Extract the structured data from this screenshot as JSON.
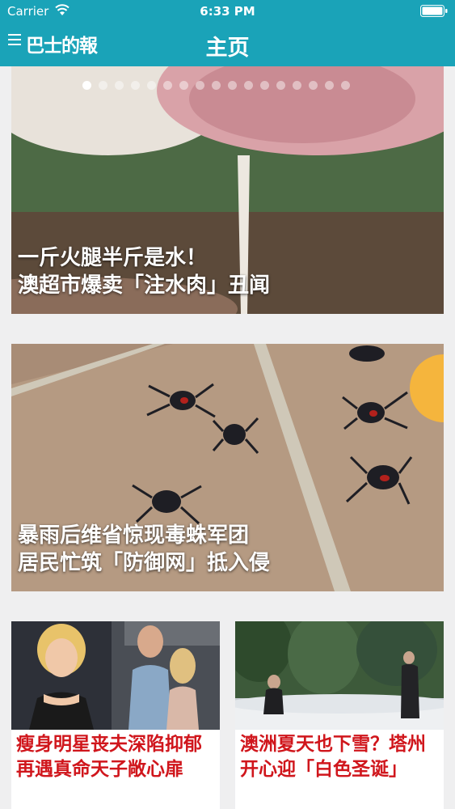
{
  "status_bar": {
    "carrier": "Carrier",
    "time": "6:33 PM"
  },
  "nav": {
    "logo": "巴士的報",
    "title": "主页"
  },
  "carousel": {
    "page_count": 17,
    "active_index": 0,
    "caption_line1": "一斤火腿半斤是水！",
    "caption_line2": "澳超市爆卖「注水肉」丑闻"
  },
  "feature2": {
    "caption_line1": "暴雨后维省惊现毒蛛军团",
    "caption_line2": "居民忙筑「防御网」抵入侵"
  },
  "tiles": [
    {
      "caption": "瘦身明星丧夫深陷抑郁 再遇真命天子敞心扉"
    },
    {
      "caption": "澳洲夏天也下雪？塔州开心迎「白色圣诞」"
    }
  ],
  "colors": {
    "brand": "#1aa3b8",
    "headline_red": "#d0161c",
    "background": "#efeff0"
  }
}
